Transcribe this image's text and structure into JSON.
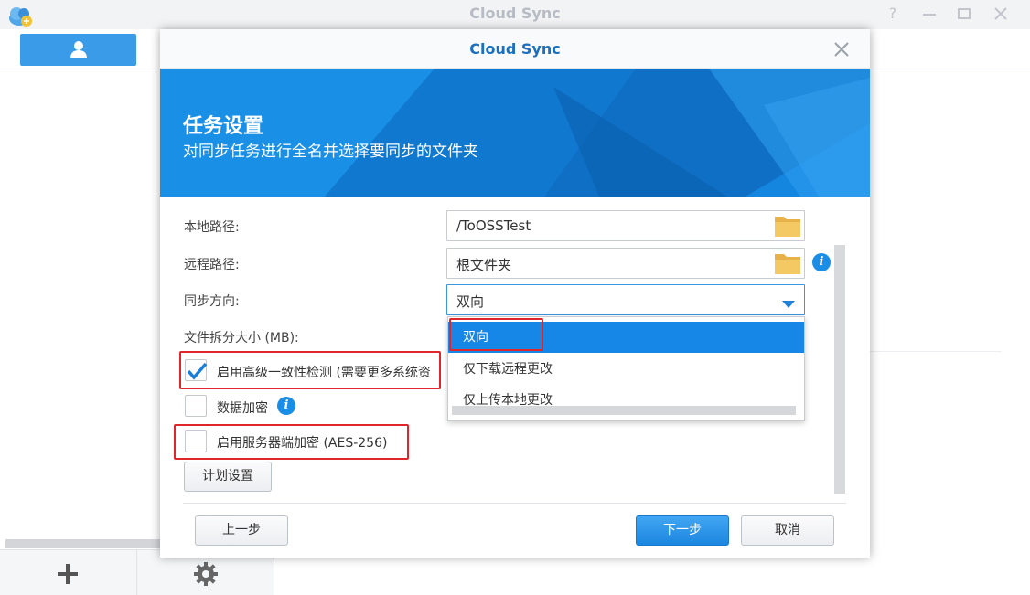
{
  "app": {
    "title": "Cloud Sync"
  },
  "dialog": {
    "title": "Cloud Sync",
    "banner_title": "任务设置",
    "banner_subtitle": "对同步任务进行全名并选择要同步的文件夹"
  },
  "form": {
    "local_path_label": "本地路径:",
    "local_path_value": "/ToOSSTest",
    "remote_path_label": "远程路径:",
    "remote_path_value": "根文件夹",
    "sync_direction_label": "同步方向:",
    "sync_direction_value": "双向",
    "split_size_label": "文件拆分大小 (MB):",
    "advanced_check_label": "启用高级一致性检测 (需要更多系统资",
    "data_encryption_label": "数据加密",
    "server_encryption_label": "启用服务器端加密 (AES-256)",
    "schedule_button": "计划设置"
  },
  "dropdown": {
    "options": [
      "双向",
      "仅下载远程更改",
      "仅上传本地更改"
    ]
  },
  "footer": {
    "prev": "上一步",
    "next": "下一步",
    "cancel": "取消"
  },
  "colors": {
    "accent": "#1687e6",
    "highlight_red": "#e0262a",
    "title_blue": "#1b6fbf"
  },
  "icons": {
    "app": "cloud-sync-logo",
    "folder": "folder-icon",
    "info": "info-icon",
    "add": "plus-icon",
    "settings": "gear-icon",
    "user": "user-icon"
  }
}
